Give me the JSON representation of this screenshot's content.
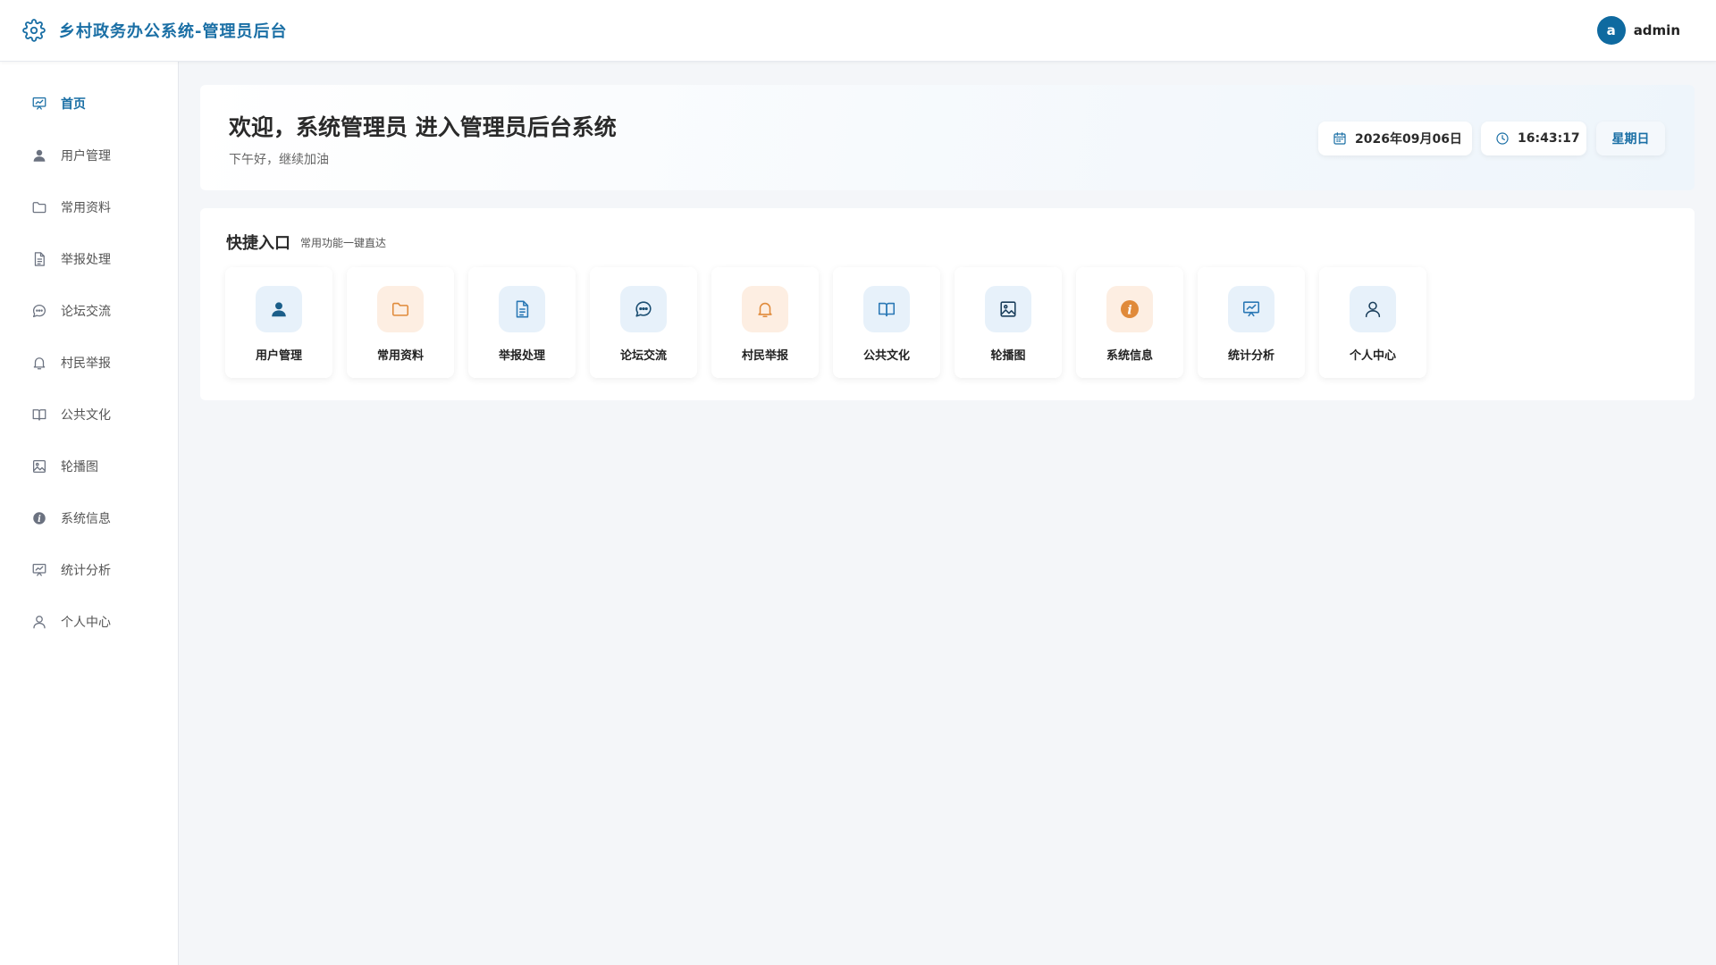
{
  "header": {
    "title": "乡村政务办公系统-管理员后台",
    "brand_icon": "gear-icon",
    "accent_color": "#1a6fa5",
    "user": {
      "avatar_letter": "a",
      "name": "admin"
    }
  },
  "sidebar": {
    "items": [
      {
        "label": "首页",
        "icon": "presentation-chart-icon",
        "active": true
      },
      {
        "label": "用户管理",
        "icon": "user-icon"
      },
      {
        "label": "常用资料",
        "icon": "folder-icon"
      },
      {
        "label": "举报处理",
        "icon": "document-icon"
      },
      {
        "label": "论坛交流",
        "icon": "chat-icon"
      },
      {
        "label": "村民举报",
        "icon": "bell-icon"
      },
      {
        "label": "公共文化",
        "icon": "book-icon"
      },
      {
        "label": "轮播图",
        "icon": "image-icon"
      },
      {
        "label": "系统信息",
        "icon": "info-icon"
      },
      {
        "label": "统计分析",
        "icon": "presentation-chart-icon"
      },
      {
        "label": "个人中心",
        "icon": "user-outline-icon"
      }
    ]
  },
  "welcome": {
    "title": "欢迎，系统管理员 进入管理员后台系统",
    "subtitle": "下午好，继续加油",
    "date": "2026年09月06日",
    "time": "16:43:17",
    "weekday": "星期日"
  },
  "quick_access": {
    "title": "快捷入口",
    "subtitle": "常用功能一键直达",
    "items": [
      {
        "label": "用户管理",
        "icon": "user-icon",
        "tint": "blue"
      },
      {
        "label": "常用资料",
        "icon": "folder-icon",
        "tint": "orange"
      },
      {
        "label": "举报处理",
        "icon": "document-icon",
        "tint": "blue"
      },
      {
        "label": "论坛交流",
        "icon": "chat-icon",
        "tint": "blue"
      },
      {
        "label": "村民举报",
        "icon": "bell-icon",
        "tint": "orange"
      },
      {
        "label": "公共文化",
        "icon": "book-icon",
        "tint": "blue"
      },
      {
        "label": "轮播图",
        "icon": "image-icon",
        "tint": "blue"
      },
      {
        "label": "系统信息",
        "icon": "info-icon",
        "tint": "orange"
      },
      {
        "label": "统计分析",
        "icon": "presentation-chart-icon",
        "tint": "blue"
      },
      {
        "label": "个人中心",
        "icon": "user-outline-icon",
        "tint": "blue"
      }
    ]
  }
}
